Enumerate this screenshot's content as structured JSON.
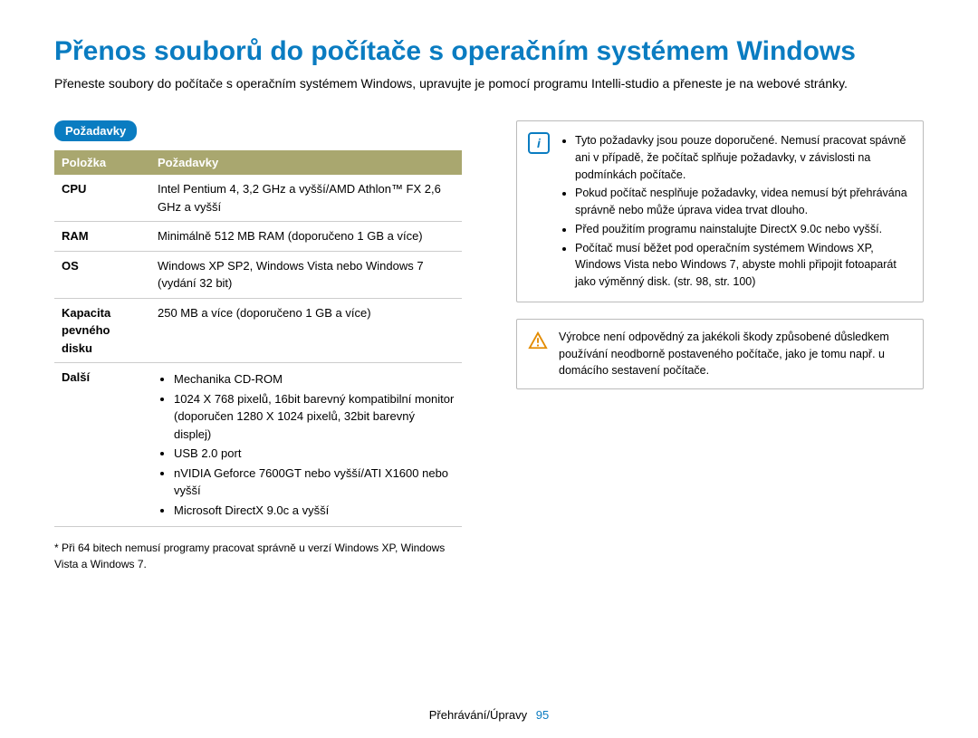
{
  "title": "Přenos souborů do počítače s operačním systémem Windows",
  "intro": "Přeneste soubory do počítače s operačním systémem Windows, upravujte je pomocí programu Intelli-studio a přeneste je na webové stránky.",
  "requirements_tag": "Požadavky",
  "table": {
    "headers": {
      "item": "Položka",
      "req": "Požadavky"
    },
    "rows": [
      {
        "label": "CPU",
        "value": "Intel Pentium 4, 3,2 GHz a vyšší/AMD Athlon™ FX 2,6 GHz a vyšší"
      },
      {
        "label": "RAM",
        "value": "Minimálně 512 MB RAM (doporučeno 1 GB a více)"
      },
      {
        "label": "OS",
        "value": "Windows XP SP2, Windows Vista nebo Windows 7 (vydání 32 bit)"
      },
      {
        "label": "Kapacita pevného disku",
        "value": "250 MB a více (doporučeno 1 GB a více)"
      },
      {
        "label": "Další",
        "value_list": [
          "Mechanika CD-ROM",
          "1024 X 768 pixelů, 16bit barevný kompatibilní monitor (doporučen 1280 X 1024 pixelů, 32bit barevný displej)",
          "USB 2.0 port",
          "nVIDIA Geforce 7600GT nebo vyšší/ATI X1600 nebo vyšší",
          "Microsoft DirectX 9.0c a vyšší"
        ]
      }
    ]
  },
  "footnote": "* Při 64 bitech nemusí programy pracovat správně u verzí Windows XP, Windows Vista a Windows 7.",
  "info_box": [
    "Tyto požadavky jsou pouze doporučené. Nemusí pracovat spávně ani v případě, že počítač splňuje požadavky, v závislosti na podmínkách počítače.",
    "Pokud počítač nesplňuje požadavky, videa nemusí být přehrávána správně nebo může úprava videa trvat dlouho.",
    "Před použitím programu nainstalujte DirectX 9.0c nebo vyšší.",
    "Počítač musí běžet pod operačním systémem Windows XP, Windows Vista nebo Windows 7, abyste mohli připojit fotoaparát jako výměnný disk. (str. 98, str. 100)"
  ],
  "warning_box": "Výrobce není odpovědný za jakékoli škody způsobené důsledkem používání neodborně postaveného počítače, jako je tomu např. u domácího sestavení počítače.",
  "footer": {
    "section": "Přehrávání/Úpravy",
    "page": "95"
  }
}
